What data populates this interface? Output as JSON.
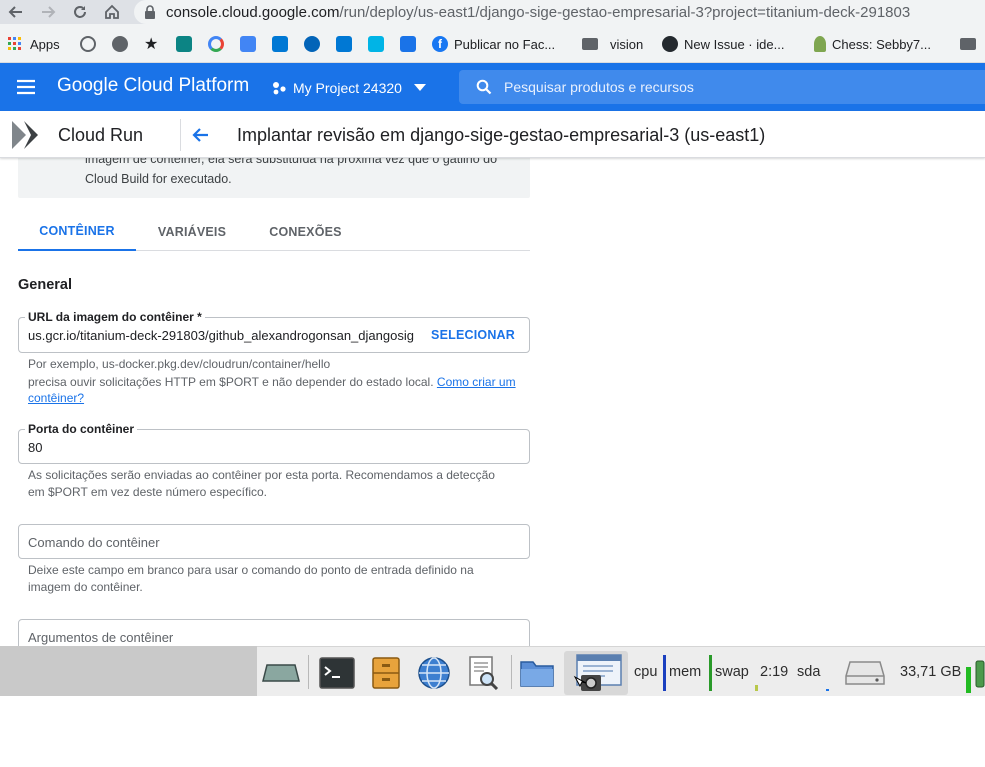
{
  "browser": {
    "url_host": "console.cloud.google.com",
    "url_path": "/run/deploy/us-east1/django-sige-gestao-empresarial-3?project=titanium-deck-291803",
    "bookmarks": [
      {
        "label": "Apps",
        "icon": "apps-grid-icon",
        "color": "#4285f4"
      },
      {
        "label": "",
        "icon": "history-icon",
        "color": "#5f6368"
      },
      {
        "label": "",
        "icon": "gear-icon",
        "color": "#5f6368"
      },
      {
        "label": "",
        "icon": "star-icon",
        "color": "#202124"
      },
      {
        "label": "",
        "icon": "bing-icon",
        "color": "#0c8484"
      },
      {
        "label": "",
        "icon": "google-icon",
        "color": "#4285f4"
      },
      {
        "label": "",
        "icon": "translate-icon",
        "color": "#4285f4"
      },
      {
        "label": "",
        "icon": "bing-icon",
        "color": "#0078d4"
      },
      {
        "label": "",
        "icon": "onedrive-icon",
        "color": "#0364b8"
      },
      {
        "label": "",
        "icon": "outlook-icon",
        "color": "#0078d4"
      },
      {
        "label": "",
        "icon": "app-icon",
        "color": "#00b4e6"
      },
      {
        "label": "",
        "icon": "photos-icon",
        "color": "#1a73e8"
      },
      {
        "label": "Publicar no Fac...",
        "icon": "facebook-icon",
        "color": "#1877f2"
      },
      {
        "label": "vision",
        "icon": "folder-icon",
        "color": "#5f6368"
      },
      {
        "label": "New Issue · ide...",
        "icon": "github-icon",
        "color": "#24292e"
      },
      {
        "label": "Chess: Sebby7...",
        "icon": "chess-icon",
        "color": "#7fa650"
      },
      {
        "label": "",
        "icon": "folder-icon",
        "color": "#5f6368"
      }
    ]
  },
  "header": {
    "product_name": "Google Cloud Platform",
    "project_name": "My Project 24320",
    "search_placeholder": "Pesquisar produtos e recursos"
  },
  "product_bar": {
    "title": "Cloud Run",
    "page_title": "Implantar revisão em django-sige-gestao-empresarial-3 (us-east1)"
  },
  "notice": {
    "line1": "imagem de contêiner, ela será substituída na próxima vez que o gatilho do",
    "line2": "Cloud Build for executado."
  },
  "tabs": [
    {
      "label": "CONTÊINER",
      "active": true
    },
    {
      "label": "VARIÁVEIS",
      "active": false
    },
    {
      "label": "CONEXÕES",
      "active": false
    }
  ],
  "form": {
    "section_title": "General",
    "image_url": {
      "label": "URL da imagem do contêiner *",
      "value": "us.gcr.io/titanium-deck-291803/github_alexandrogonsan_djangosig",
      "action": "SELECIONAR",
      "hint_line1": "Por exemplo, us-docker.pkg.dev/cloudrun/container/hello",
      "hint_line2": "precisa ouvir solicitações HTTP em $PORT e não depender do estado local.",
      "hint_link": "Como criar um contêiner?"
    },
    "port": {
      "label": "Porta do contêiner",
      "value": "80",
      "hint": "As solicitações serão enviadas ao contêiner por esta porta. Recomendamos a detecção em $PORT em vez deste número específico."
    },
    "command": {
      "placeholder": "Comando do contêiner",
      "hint": "Deixe este campo em branco para usar o comando do ponto de entrada definido na imagem do contêiner."
    },
    "args": {
      "placeholder": "Argumentos de contêiner"
    }
  },
  "taskbar": {
    "cpu_label": "cpu",
    "mem_label": "mem",
    "swap_label": "swap",
    "clock": "2:19",
    "disk_label": "sda",
    "disk_free": "33,71 GB"
  }
}
